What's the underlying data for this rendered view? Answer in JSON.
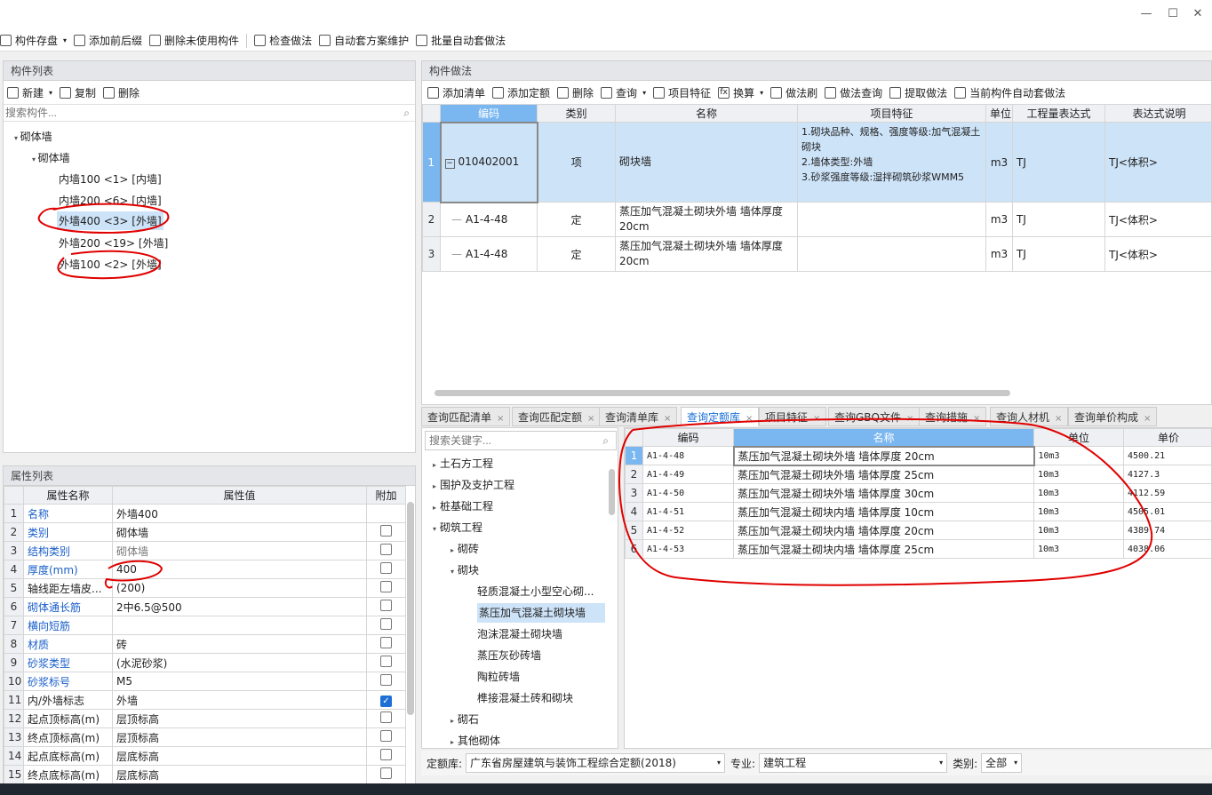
{
  "window": {
    "min": "—",
    "max": "☐",
    "close": "✕"
  },
  "toolbar": {
    "save": "构件存盘",
    "add_prefix": "添加前后缀",
    "delete_unused": "删除未使用构件",
    "check": "检查做法",
    "auto_plan": "自动套方案维护",
    "batch_auto": "批量自动套做法"
  },
  "left": {
    "title": "构件列表",
    "new": "新建",
    "copy": "复制",
    "delete": "删除",
    "search_placeholder": "搜索构件...",
    "tree": {
      "root": "砌体墙",
      "child": "砌体墙",
      "items": [
        "内墙100 <1> [内墙]",
        "内墙200 <6> [内墙]",
        "外墙400 <3> [外墙]",
        "外墙200 <19> [外墙]",
        "外墙100 <2> [外墙]"
      ]
    }
  },
  "props": {
    "title": "属性列表",
    "col_name": "属性名称",
    "col_value": "属性值",
    "col_extra": "附加",
    "rows": [
      {
        "n": "1",
        "name": "名称",
        "value": "外墙400",
        "blue": true,
        "chk": null
      },
      {
        "n": "2",
        "name": "类别",
        "value": "砌体墙",
        "blue": true,
        "chk": false
      },
      {
        "n": "3",
        "name": "结构类别",
        "value": "砌体墙",
        "blue": true,
        "chk": false
      },
      {
        "n": "4",
        "name": "厚度(mm)",
        "value": "400",
        "blue": true,
        "chk": false
      },
      {
        "n": "5",
        "name": "轴线距左墙皮...",
        "value": "(200)",
        "blue": false,
        "chk": false
      },
      {
        "n": "6",
        "name": "砌体通长筋",
        "value": "2中6.5@500",
        "blue": true,
        "chk": false
      },
      {
        "n": "7",
        "name": "横向短筋",
        "value": "",
        "blue": true,
        "chk": false
      },
      {
        "n": "8",
        "name": "材质",
        "value": "砖",
        "blue": true,
        "chk": false
      },
      {
        "n": "9",
        "name": "砂浆类型",
        "value": "(水泥砂浆)",
        "blue": true,
        "chk": false
      },
      {
        "n": "10",
        "name": "砂浆标号",
        "value": "M5",
        "blue": true,
        "chk": false
      },
      {
        "n": "11",
        "name": "内/外墙标志",
        "value": "外墙",
        "blue": false,
        "chk": true
      },
      {
        "n": "12",
        "name": "起点顶标高(m)",
        "value": "层顶标高",
        "blue": false,
        "chk": false
      },
      {
        "n": "13",
        "name": "终点顶标高(m)",
        "value": "层顶标高",
        "blue": false,
        "chk": false
      },
      {
        "n": "14",
        "name": "起点底标高(m)",
        "value": "层底标高",
        "blue": false,
        "chk": false
      },
      {
        "n": "15",
        "name": "终点底标高(m)",
        "value": "层底标高",
        "blue": false,
        "chk": false
      }
    ]
  },
  "method": {
    "title": "构件做法",
    "toolbar": [
      "添加清单",
      "添加定额",
      "删除",
      "查询",
      "项目特征",
      "换算",
      "做法刷",
      "做法查询",
      "提取做法",
      "当前构件自动套做法"
    ],
    "headers": [
      "编码",
      "类别",
      "名称",
      "项目特征",
      "单位",
      "工程量表达式",
      "表达式说明"
    ],
    "rows": [
      {
        "n": "1",
        "code": "010402001",
        "type": "项",
        "name": "砌块墙",
        "feature": "1.砌块品种、规格、强度等级:加气混凝土砌块\n2.墙体类型:外墙\n3.砂浆强度等级:湿拌砌筑砂浆WMM5",
        "unit": "m3",
        "expr": "TJ",
        "desc": "TJ<体积>"
      },
      {
        "n": "2",
        "code": "A1-4-48",
        "type": "定",
        "name": "蒸压加气混凝土砌块外墙 墙体厚度20cm",
        "feature": "",
        "unit": "m3",
        "expr": "TJ",
        "desc": "TJ<体积>"
      },
      {
        "n": "3",
        "code": "A1-4-48",
        "type": "定",
        "name": "蒸压加气混凝土砌块外墙 墙体厚度20cm",
        "feature": "",
        "unit": "m3",
        "expr": "TJ",
        "desc": "TJ<体积>"
      }
    ]
  },
  "tabs": [
    "查询匹配清单",
    "查询匹配定额",
    "查询清单库",
    "查询定额库",
    "项目特征",
    "查询GBQ文件",
    "查询措施",
    "查询人材机",
    "查询单价构成"
  ],
  "lib": {
    "search_placeholder": "搜索关键字...",
    "tree": [
      "土石方工程",
      "围护及支护工程",
      "桩基础工程",
      "砌筑工程",
      "砌砖",
      "砌块",
      "轻质混凝土小型空心砌...",
      "蒸压加气混凝土砌块墙",
      "泡沫混凝土砌块墙",
      "蒸压灰砂砖墙",
      "陶粒砖墙",
      "榫接混凝土砖和砌块",
      "砌石",
      "其他砌体"
    ],
    "headers": [
      "编码",
      "名称",
      "单位",
      "单价"
    ],
    "rows": [
      {
        "n": "1",
        "code": "A1-4-48",
        "name": "蒸压加气混凝土砌块外墙 墙体厚度 20cm",
        "unit": "10m3",
        "price": "4500.21"
      },
      {
        "n": "2",
        "code": "A1-4-49",
        "name": "蒸压加气混凝土砌块外墙 墙体厚度 25cm",
        "unit": "10m3",
        "price": "4127.3"
      },
      {
        "n": "3",
        "code": "A1-4-50",
        "name": "蒸压加气混凝土砌块外墙 墙体厚度 30cm",
        "unit": "10m3",
        "price": "4112.59"
      },
      {
        "n": "4",
        "code": "A1-4-51",
        "name": "蒸压加气混凝土砌块内墙 墙体厚度 10cm",
        "unit": "10m3",
        "price": "4505.01"
      },
      {
        "n": "5",
        "code": "A1-4-52",
        "name": "蒸压加气混凝土砌块内墙 墙体厚度 20cm",
        "unit": "10m3",
        "price": "4389.74"
      },
      {
        "n": "6",
        "code": "A1-4-53",
        "name": "蒸压加气混凝土砌块内墙 墙体厚度 25cm",
        "unit": "10m3",
        "price": "4038.06"
      }
    ],
    "footer": {
      "lib_label": "定额库:",
      "lib_value": "广东省房屋建筑与装饰工程综合定额(2018)",
      "major_label": "专业:",
      "major_value": "建筑工程",
      "cat_label": "类别:",
      "cat_value": "全部"
    }
  },
  "colors": {
    "accent": "#1a6fd6",
    "selected": "#cde3f8",
    "annotation": "#e00000"
  }
}
